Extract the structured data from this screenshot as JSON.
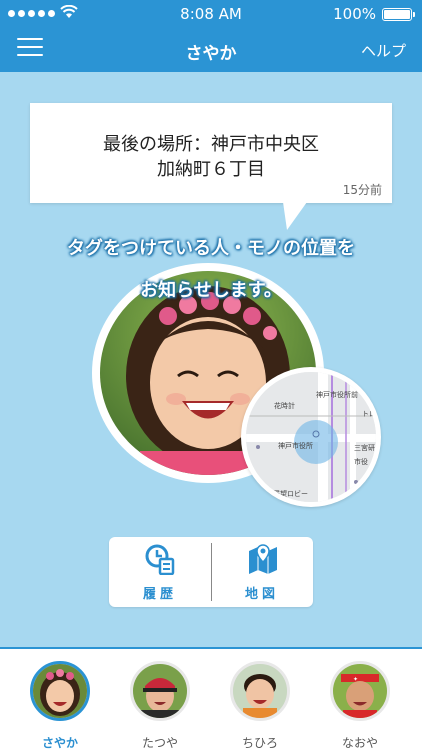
{
  "status_bar": {
    "time": "8:08 AM",
    "battery": "100%"
  },
  "nav": {
    "title": "さやか",
    "help_label": "ヘルプ"
  },
  "location": {
    "line1": "最後の場所：神戸市中央区",
    "line2": "加納町６丁目",
    "time_ago": "15分前"
  },
  "tagline": {
    "line1": "タグをつけている人・モノの位置を",
    "line2": "お知らせします。"
  },
  "map_labels": {
    "a": "神戸市役所前",
    "b": "花時計",
    "c": "神戸市役所",
    "d": "三宮研",
    "e": "市役",
    "f": "示展望ロビー",
    "g": "トロ"
  },
  "actions": {
    "history_label": "履歴",
    "map_label": "地図"
  },
  "tabs": [
    {
      "name": "さやか",
      "active": true
    },
    {
      "name": "たつや",
      "active": false
    },
    {
      "name": "ちひろ",
      "active": false
    },
    {
      "name": "なおや",
      "active": false
    }
  ],
  "colors": {
    "primary": "#2b94d4",
    "background": "#a7d8f0",
    "accent_text": "#2b8fd0"
  }
}
